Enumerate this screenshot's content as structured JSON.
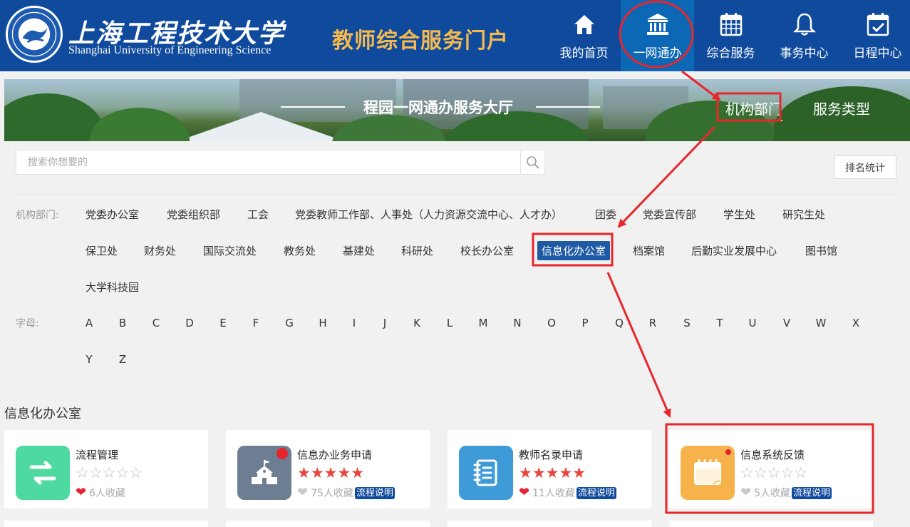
{
  "header": {
    "logo_cn": "上海工程技术大学",
    "logo_en": "Shanghai University of Engineering Science",
    "portal_title": "教师综合服务门户",
    "nav": [
      {
        "label": "我的首页",
        "icon": "home-icon"
      },
      {
        "label": "一网通办",
        "icon": "institution-icon",
        "active": true
      },
      {
        "label": "综合服务",
        "icon": "grid-calendar-icon"
      },
      {
        "label": "事务中心",
        "icon": "bell-icon"
      },
      {
        "label": "日程中心",
        "icon": "calendar-check-icon"
      }
    ]
  },
  "banner": {
    "title": "程园一网通办服务大厅",
    "tabs": [
      {
        "label": "机构部门",
        "active": true
      },
      {
        "label": "服务类型",
        "active": false
      }
    ]
  },
  "search": {
    "placeholder": "搜索你想要的",
    "value": ""
  },
  "rank_button": "排名统计",
  "filters": {
    "dept_label": "机构部门:",
    "departments": [
      "党委办公室",
      "党委组织部",
      "工会",
      "党委教师工作部、人事处（人力资源交流中心、人才办）",
      "团委",
      "党委宣传部",
      "学生处",
      "研究生处",
      "保卫处",
      "财务处",
      "国际交流处",
      "教务处",
      "基建处",
      "科研处",
      "校长办公室",
      "信息化办公室",
      "档案馆",
      "后勤实业发展中心",
      "图书馆",
      "大学科技园"
    ],
    "active_department": "信息化办公室",
    "letter_label": "字母:",
    "letters": [
      "A",
      "B",
      "C",
      "D",
      "E",
      "F",
      "G",
      "H",
      "I",
      "J",
      "K",
      "L",
      "M",
      "N",
      "O",
      "P",
      "Q",
      "R",
      "S",
      "T",
      "U",
      "V",
      "W",
      "X",
      "Y",
      "Z"
    ]
  },
  "section_title": "信息化办公室",
  "cards": [
    {
      "name": "流程管理",
      "rating": 0,
      "stars": "☆☆☆☆☆",
      "favorites": "6人收藏",
      "heart": "red",
      "flow_label": "",
      "icon": "swap-arrows-icon",
      "icon_color": "#4dd9a0"
    },
    {
      "name": "信息办业务申请",
      "rating": 5,
      "stars": "★★★★★",
      "favorites": "75人收藏",
      "heart": "gray",
      "flow_label": "流程说明",
      "icon": "school-building-icon",
      "icon_color": "#6e7e92"
    },
    {
      "name": "教师名录申请",
      "rating": 5,
      "stars": "★★★★★",
      "favorites": "11人收藏",
      "heart": "red",
      "flow_label": "流程说明",
      "icon": "notebook-icon",
      "icon_color": "#3f9ad8"
    },
    {
      "name": "信息系统反馈",
      "rating": 0,
      "stars": "☆☆☆☆☆",
      "favorites": "5人收藏",
      "heart": "gray",
      "flow_label": "流程说明",
      "icon": "calendar-note-icon",
      "icon_color": "#f7b24b"
    }
  ],
  "colors": {
    "header_bg": "#0f4a9c",
    "nav_active_bg": "#0c67b5",
    "portal_title": "#f5b94e",
    "annotation_red": "#e8262b"
  }
}
